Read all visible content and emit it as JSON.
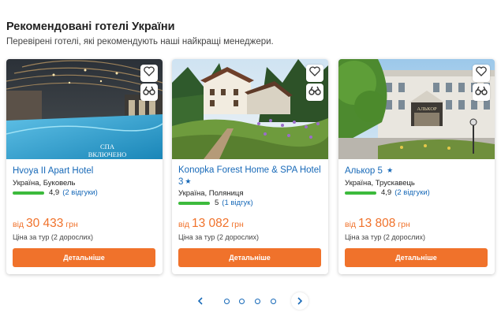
{
  "section": {
    "title": "Рекомендовані готелі України",
    "subtitle": "Перевірені готелі, які рекомендують наші найкращі менеджери."
  },
  "colors": {
    "link": "#1769b8",
    "accent": "#f0722b",
    "rating_bar": "#3cba3c"
  },
  "icons": {
    "favorite": "heart-icon",
    "compare": "binoculars-icon",
    "prev": "chevron-left-icon",
    "next": "chevron-right-icon"
  },
  "hotels": [
    {
      "name": "Hvoya II Apart Hotel",
      "stars": "",
      "location": "Україна, Буковель",
      "rating": "4,9",
      "reviews": "(2 відгуки)",
      "price_prefix": "від",
      "price": "30 433",
      "currency": "грн",
      "price_note": "Ціна за тур (2 дорослих)",
      "button": "Детальніше",
      "photo_caption_1": "СПА",
      "photo_caption_2": "ВКЛЮЧЕНО"
    },
    {
      "name": "Konopka Forest Home & SPA Hotel 3",
      "stars": "★",
      "location": "Україна, Поляниця",
      "rating": "5",
      "reviews": "(1 відгук)",
      "price_prefix": "від",
      "price": "13 082",
      "currency": "грн",
      "price_note": "Ціна за тур (2 дорослих)",
      "button": "Детальніше"
    },
    {
      "name": "Алькор 5",
      "stars": "★",
      "location": "Україна, Трускавець",
      "rating": "4,9",
      "reviews": "(2 відгуки)",
      "price_prefix": "від",
      "price": "13 808",
      "currency": "грн",
      "price_note": "Ціна за тур (2 дорослих)",
      "button": "Детальніше",
      "photo_sign": "АЛЬКОР"
    }
  ],
  "pagination": {
    "page_count": 4
  }
}
